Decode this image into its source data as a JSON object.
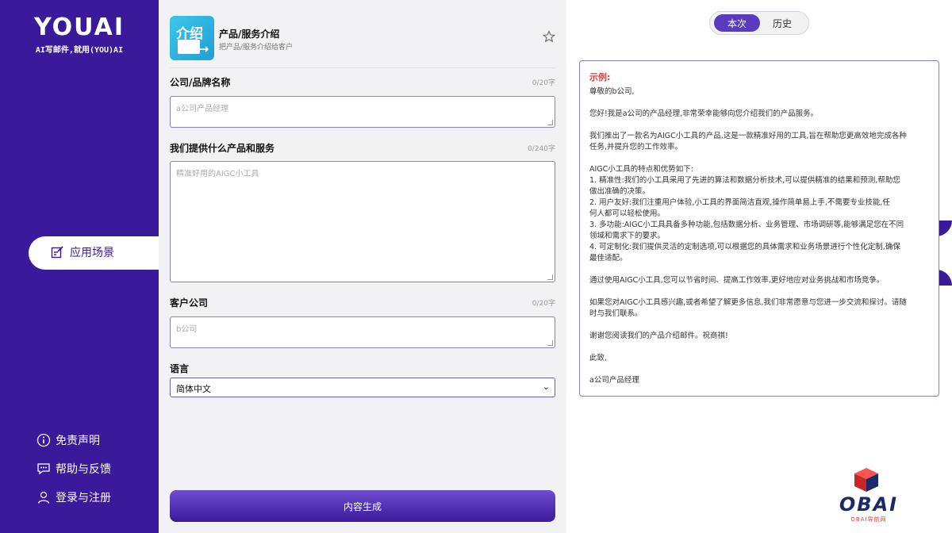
{
  "sidebar": {
    "logo": "YOUAI",
    "slogan": "AI写邮件,就用(YOU)AI",
    "active_nav": "应用场景",
    "links": [
      "免责声明",
      "帮助与反馈",
      "登录与注册"
    ]
  },
  "app": {
    "icon_text": "介绍",
    "title": "产品/服务介绍",
    "subtitle": "把产品/服务介绍给客户"
  },
  "form": {
    "company": {
      "label": "公司/品牌名称",
      "count": "0/20字",
      "placeholder": "a公司产品经理"
    },
    "product": {
      "label": "我们提供什么产品和服务",
      "count": "0/240字",
      "placeholder": "精准好用的AIGC小工具"
    },
    "customer": {
      "label": "客户公司",
      "count": "0/20字",
      "placeholder": "b公司"
    },
    "language": {
      "label": "语言",
      "value": "简体中文"
    },
    "generate_label": "内容生成"
  },
  "tabs": [
    "本次",
    "历史"
  ],
  "result": {
    "title": "示例:",
    "paragraphs": [
      [
        "尊敬的b公司,"
      ],
      [
        "您好!我是a公司的产品经理,非常荣幸能够向您介绍我们的产品服务。"
      ],
      [
        "我们推出了一款名为AIGC小工具的产品,这是一款精准好用的工具,旨在帮助您更高效地完成各种",
        "任务,并提升您的工作效率。"
      ],
      [
        "AIGC小工具的特点和优势如下:",
        "1. 精准性:我们的小工具采用了先进的算法和数据分析技术,可以提供精准的结果和预测,帮助您",
        "做出准确的决策。",
        "2. 用户友好:我们注重用户体验,小工具的界面简洁直观,操作简单易上手,不需要专业技能,任",
        "何人都可以轻松使用。",
        "3. 多功能:AIGC小工具具备多种功能,包括数据分析、业务管理、市场调研等,能够满足您在不同",
        "领域和需求下的要求。",
        "4. 可定制化:我们提供灵活的定制选项,可以根据您的具体需求和业务场景进行个性化定制,确保",
        "最佳适配。"
      ],
      [
        "通过使用AIGC小工具,您可以节省时间、提高工作效率,更好地应对业务挑战和市场竞争。"
      ],
      [
        "如果您对AIGC小工具感兴趣,或者希望了解更多信息,我们非常愿意与您进一步交流和探讨。请随",
        "时与我们联系。"
      ],
      [
        "谢谢您阅读我们的产品介绍邮件。祝商祺!"
      ],
      [
        "此致,"
      ],
      [
        "a公司产品经理"
      ]
    ]
  },
  "watermark": {
    "text": "OBAI",
    "sub": "OBAI导航网"
  },
  "colors": {
    "brand": "#3a1a9a",
    "accent": "#5a3bbf",
    "example_red": "#e53935"
  }
}
